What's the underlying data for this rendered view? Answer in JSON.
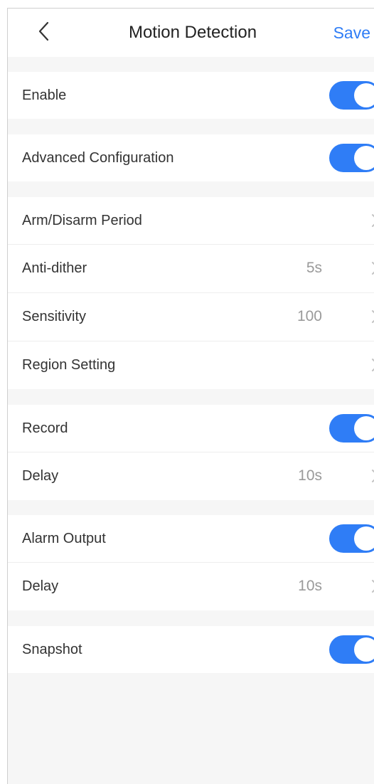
{
  "header": {
    "title": "Motion Detection",
    "save_label": "Save",
    "back_icon": "chevron-left-icon"
  },
  "rows": {
    "enable": {
      "label": "Enable",
      "toggle_on": true
    },
    "advanced": {
      "label": "Advanced Configuration",
      "toggle_on": true
    },
    "arm_disarm": {
      "label": "Arm/Disarm Period",
      "value": ""
    },
    "anti_dither": {
      "label": "Anti-dither",
      "value": "5s"
    },
    "sensitivity": {
      "label": "Sensitivity",
      "value": "100"
    },
    "region": {
      "label": "Region Setting",
      "value": ""
    },
    "record": {
      "label": "Record",
      "toggle_on": true
    },
    "record_delay": {
      "label": "Delay",
      "value": "10s"
    },
    "alarm_output": {
      "label": "Alarm Output",
      "toggle_on": true
    },
    "alarm_delay": {
      "label": "Delay",
      "value": "10s"
    },
    "snapshot": {
      "label": "Snapshot",
      "toggle_on": true
    }
  },
  "colors": {
    "accent": "#2f7df6",
    "background": "#f6f6f6",
    "row_background": "#ffffff",
    "label_text": "#333333",
    "value_text": "#9a9a9a"
  }
}
